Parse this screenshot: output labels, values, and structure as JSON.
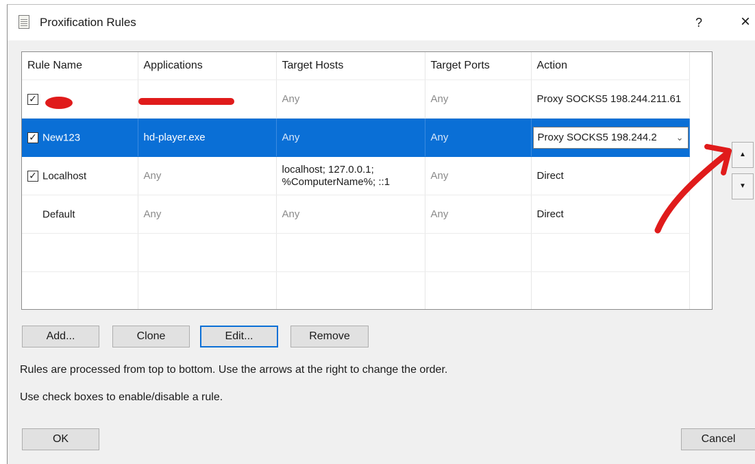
{
  "window": {
    "title": "Proxification Rules",
    "help_label": "?",
    "close_label": "×"
  },
  "table": {
    "columns": [
      "Rule Name",
      "Applications",
      "Target Hosts",
      "Target Ports",
      "Action"
    ],
    "rows": [
      {
        "checked": true,
        "name": "",
        "applications": "",
        "target_hosts": "Any",
        "target_ports": "Any",
        "action": "Proxy SOCKS5 198.244.211.61"
      },
      {
        "checked": true,
        "name": "New123",
        "applications": "hd-player.exe",
        "target_hosts": "Any",
        "target_ports": "Any",
        "action": "Proxy SOCKS5 198.244.2"
      },
      {
        "checked": true,
        "name": "Localhost",
        "applications": "Any",
        "target_hosts": "localhost; 127.0.0.1; %ComputerName%; ::1",
        "target_ports": "Any",
        "action": "Direct"
      },
      {
        "checked": false,
        "name": "Default",
        "applications": "Any",
        "target_hosts": "Any",
        "target_ports": "Any",
        "action": "Direct"
      }
    ]
  },
  "buttons": {
    "add": "Add...",
    "clone": "Clone",
    "edit": "Edit...",
    "remove": "Remove",
    "ok": "OK",
    "cancel": "Cancel"
  },
  "info": {
    "line1": "Rules are processed from top to bottom. Use the arrows at the right to change the order.",
    "line2": "Use check boxes to enable/disable a rule."
  },
  "colors": {
    "selection": "#0a6fd6",
    "annotation": "#e01b1b"
  },
  "icons": {
    "title": "rules-document-icon",
    "move_up": "arrow-up-icon",
    "move_down": "arrow-down-icon",
    "dropdown": "chevron-down-icon",
    "checkbox": "check-icon"
  }
}
